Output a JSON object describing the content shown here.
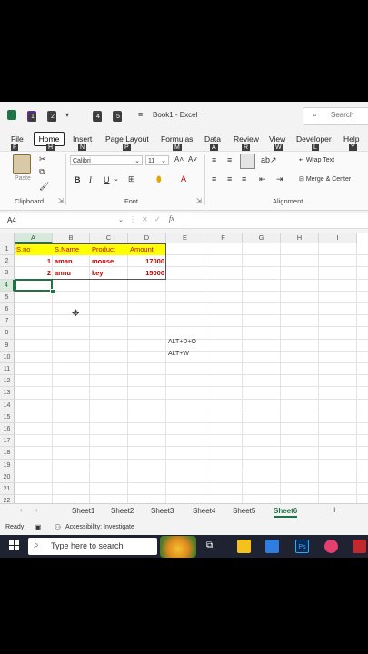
{
  "titlebar": {
    "qat_keytips": [
      "1",
      "2",
      "4",
      "5"
    ],
    "title": "Book1 - Excel",
    "search_placeholder": "Search"
  },
  "ribbon_tabs": [
    {
      "label": "File",
      "keytip": "F"
    },
    {
      "label": "Home",
      "keytip": "H"
    },
    {
      "label": "Insert",
      "keytip": "N"
    },
    {
      "label": "Page Layout",
      "keytip": "P"
    },
    {
      "label": "Formulas",
      "keytip": "M"
    },
    {
      "label": "Data",
      "keytip": "A"
    },
    {
      "label": "Review",
      "keytip": "R"
    },
    {
      "label": "View",
      "keytip": "W"
    },
    {
      "label": "Developer",
      "keytip": "L"
    },
    {
      "label": "Help",
      "keytip": "Y"
    }
  ],
  "ribbon": {
    "clipboard": {
      "paste_label": "Paste",
      "group": "Clipboard"
    },
    "font": {
      "name": "Calibri",
      "size": "11",
      "group": "Font"
    },
    "alignment": {
      "wrap": "Wrap Text",
      "merge": "Merge & Center",
      "group": "Alignment"
    }
  },
  "formula_bar": {
    "name_box": "A4",
    "fx": "fx",
    "value": ""
  },
  "columns": [
    "A",
    "B",
    "C",
    "D",
    "E",
    "F",
    "G",
    "H",
    "I"
  ],
  "rows": [
    "1",
    "2",
    "3",
    "4",
    "5",
    "6",
    "7",
    "8",
    "9",
    "10",
    "11",
    "12",
    "13",
    "14",
    "15",
    "16",
    "17",
    "18",
    "19",
    "20",
    "21",
    "22"
  ],
  "table": {
    "headers": [
      "S.no",
      "S.Name",
      "Product",
      "Amount"
    ],
    "rows": [
      [
        "1",
        "aman",
        "mouse",
        "17000"
      ],
      [
        "2",
        "annu",
        "key",
        "15000"
      ]
    ]
  },
  "notes": [
    "ALT+D+O",
    "ALT+W"
  ],
  "sheets": [
    "Sheet1",
    "Sheet2",
    "Sheet3",
    "Sheet4",
    "Sheet5",
    "Sheet6"
  ],
  "active_sheet": "Sheet6",
  "add_sheet": "+",
  "status": {
    "ready": "Ready",
    "accessibility": "Accessibility: Investigate"
  },
  "taskbar": {
    "search_placeholder": "Type here to search"
  },
  "colors": {
    "excel_green": "#217346",
    "header_fill": "#ffff00",
    "text_red": "#c00000"
  }
}
